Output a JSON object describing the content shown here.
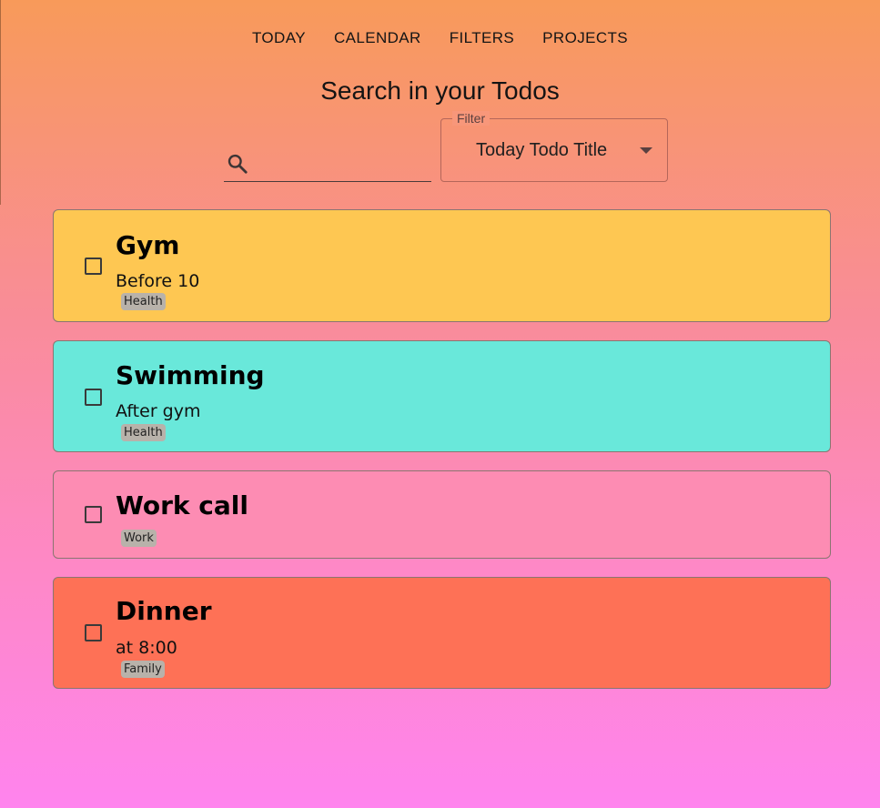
{
  "nav": {
    "items": [
      "TODAY",
      "CALENDAR",
      "FILTERS",
      "PROJECTS"
    ]
  },
  "search": {
    "title": "Search in your Todos",
    "placeholder": "",
    "value": ""
  },
  "filter": {
    "label": "Filter",
    "selected": "Today Todo Title"
  },
  "todos": [
    {
      "title": "Gym",
      "description": "Before 10",
      "tag": "Health",
      "color": "#fec752",
      "checked": false
    },
    {
      "title": "Swimming",
      "description": "After gym",
      "tag": "Health",
      "color": "#69e8da",
      "checked": false
    },
    {
      "title": "Work call",
      "description": "",
      "tag": "Work",
      "color": "#fd8cb3",
      "checked": false
    },
    {
      "title": "Dinner",
      "description": "at 8:00",
      "tag": "Family",
      "color": "#fe7156",
      "checked": false
    }
  ],
  "icons": {
    "search": "search-icon",
    "dropdown": "chevron-down-icon"
  }
}
